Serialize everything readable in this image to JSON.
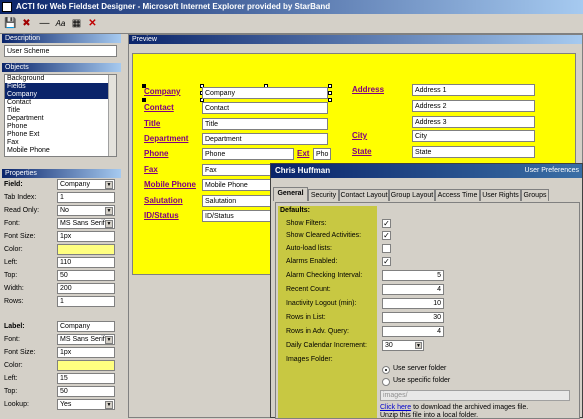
{
  "window": {
    "title": "ACTI for Web Fieldset Designer - Microsoft Internet Explorer provided by StarBand"
  },
  "toolbar": {
    "icons": [
      "save-icon",
      "delete-icon",
      "line-icon",
      "font-icon",
      "layout-icon",
      "close-x-icon"
    ],
    "glyphs": [
      "💾",
      "✖",
      "—",
      "Aa",
      "▦",
      "✕"
    ]
  },
  "left": {
    "description_header": "Description",
    "description_value": "User Scheme",
    "objects_header": "Objects",
    "objects": [
      "Background",
      "Fields",
      "Company",
      "Contact",
      "Title",
      "Department",
      "Phone",
      "Phone Ext",
      "Fax",
      "Mobile Phone"
    ],
    "properties_header": "Properties",
    "field_props": [
      {
        "label": "Field:",
        "value": "Company",
        "dropdown": true,
        "bold": true
      },
      {
        "label": "Tab Index:",
        "value": "1"
      },
      {
        "label": "Read Only:",
        "value": "No",
        "dropdown": true
      },
      {
        "label": "Font:",
        "value": "MS Sans Serif",
        "dropdown": true
      },
      {
        "label": "Font Size:",
        "value": "1px"
      },
      {
        "label": "Color:",
        "value": "",
        "yellow": true
      },
      {
        "label": "Left:",
        "value": "110"
      },
      {
        "label": "Top:",
        "value": "50"
      },
      {
        "label": "Width:",
        "value": "200"
      },
      {
        "label": "Rows:",
        "value": "1"
      }
    ],
    "label_props": [
      {
        "label": "Label:",
        "value": "Company",
        "bold": true
      },
      {
        "label": "Font:",
        "value": "MS Sans Serif",
        "dropdown": true
      },
      {
        "label": "Font Size:",
        "value": "1px"
      },
      {
        "label": "Color:",
        "value": "",
        "yellow": true
      },
      {
        "label": "Left:",
        "value": "15"
      },
      {
        "label": "Top:",
        "value": "50"
      },
      {
        "label": "Lookup:",
        "value": "Yes",
        "dropdown": true
      }
    ]
  },
  "preview": {
    "header": "Preview",
    "labels": {
      "company": "Company",
      "contact": "Contact",
      "title": "Title",
      "department": "Department",
      "phone": "Phone",
      "ext": "Ext",
      "fax": "Fax",
      "mobile": "Mobile Phone",
      "salutation": "Salutation",
      "id": "ID/Status",
      "address": "Address",
      "city": "City",
      "state": "State"
    },
    "values": {
      "company": "Company",
      "contact": "Contact",
      "title": "Title",
      "department": "Department",
      "phone": "Phone",
      "ext": "Pho",
      "fax": "Fax",
      "mobile": "Mobile Phone",
      "salutation": "Salutation",
      "id": "ID/Status",
      "address1": "Address 1",
      "address2": "Address 2",
      "address3": "Address 3",
      "city": "City",
      "state": "State"
    }
  },
  "dialog": {
    "title": "Chris Huffman",
    "right_title": "User Preferences",
    "tabs": [
      "General",
      "Security",
      "Contact Layout",
      "Group Layout",
      "Access Time",
      "User Rights",
      "Groups"
    ],
    "defaults_label": "Defaults:",
    "checks": [
      {
        "label": "Show Filters:",
        "checked": true
      },
      {
        "label": "Show Cleared Activities:",
        "checked": true
      },
      {
        "label": "Auto-load lists:",
        "checked": false
      },
      {
        "label": "Alarms Enabled:",
        "checked": true
      }
    ],
    "nums": [
      {
        "label": "Alarm Checking Interval:",
        "value": "5"
      },
      {
        "label": "Recent Count:",
        "value": "4"
      },
      {
        "label": "Inactivity Logout (min):",
        "value": "10"
      },
      {
        "label": "Rows in List:",
        "value": "30"
      },
      {
        "label": "Rows in Adv. Query:",
        "value": "4"
      }
    ],
    "calendar_label": "Daily Calendar Increment:",
    "calendar_value": "30",
    "images_label": "Images Folder:",
    "radio_server": "Use server folder",
    "radio_specific": "Use specific folder",
    "images_path": "images/",
    "click_here": "Click here",
    "download_text": " to download the archived images file.",
    "unzip_text": "Unzip this file into a local folder."
  }
}
